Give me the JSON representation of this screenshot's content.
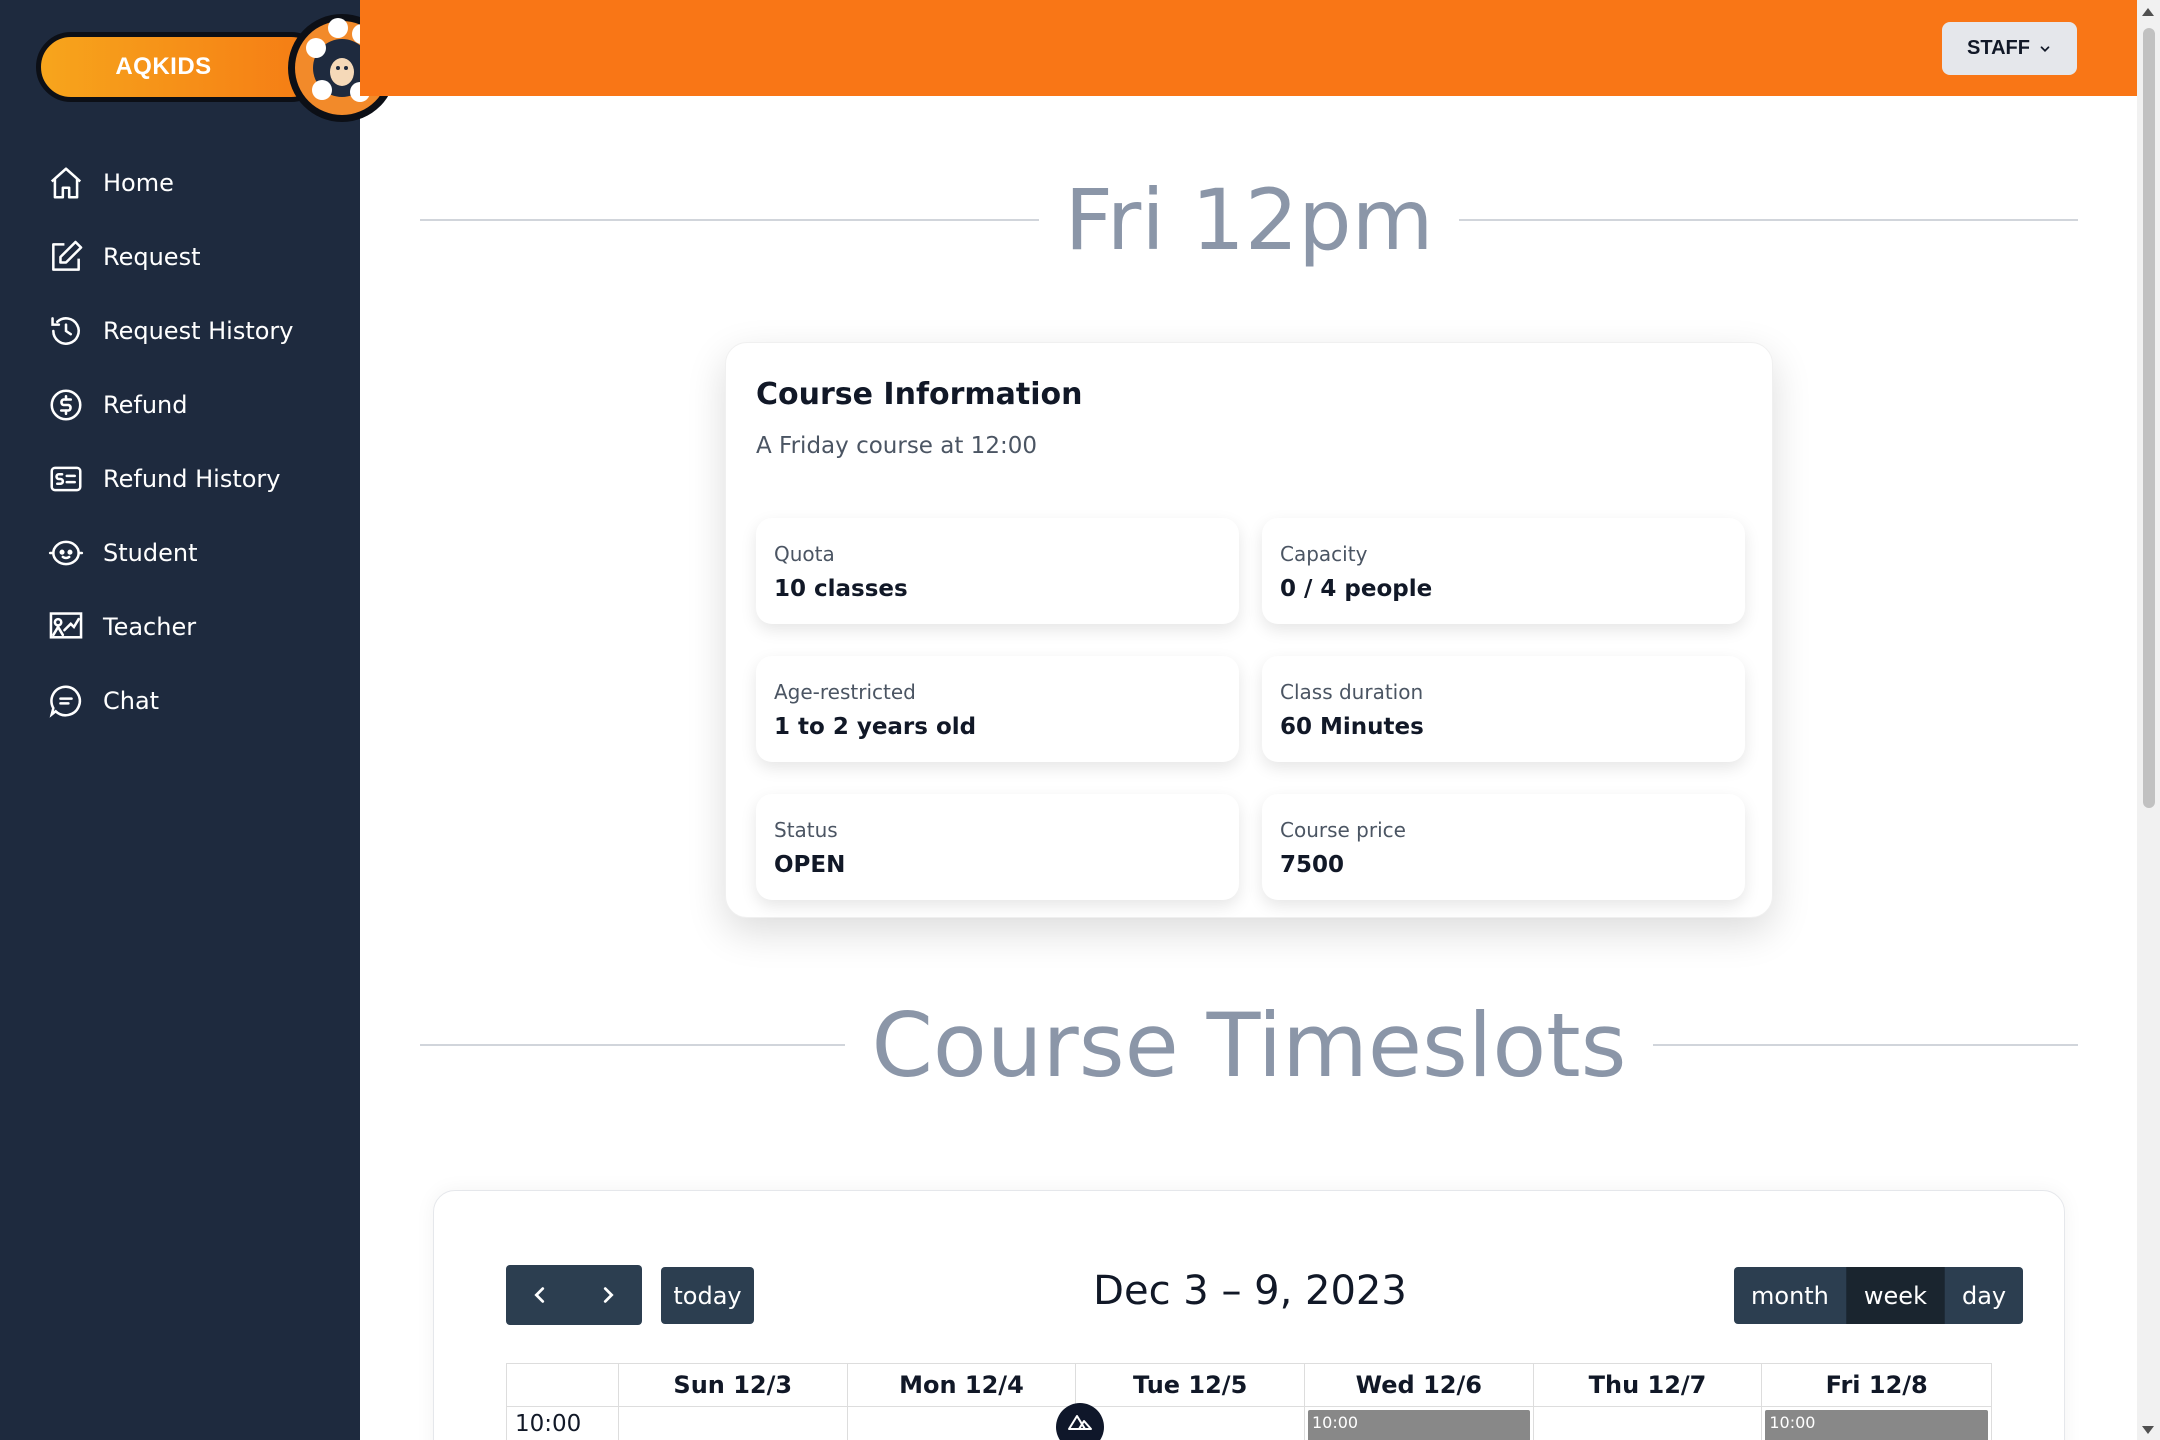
{
  "brand": {
    "name": "AQKIDS"
  },
  "nav": [
    {
      "label": "Home",
      "icon": "home-icon"
    },
    {
      "label": "Request",
      "icon": "edit-icon"
    },
    {
      "label": "Request History",
      "icon": "history-icon"
    },
    {
      "label": "Refund",
      "icon": "dollar-icon"
    },
    {
      "label": "Refund History",
      "icon": "receipt-icon"
    },
    {
      "label": "Student",
      "icon": "baby-icon"
    },
    {
      "label": "Teacher",
      "icon": "chalkboard-icon"
    },
    {
      "label": "Chat",
      "icon": "chat-icon"
    }
  ],
  "topbar": {
    "user_menu": "STAFF"
  },
  "page": {
    "title": "Fri 12pm"
  },
  "course_info": {
    "title": "Course Information",
    "subtitle": "A Friday course at 12:00",
    "fields": [
      {
        "label": "Quota",
        "value": "10 classes"
      },
      {
        "label": "Capacity",
        "value": "0 / 4 people"
      },
      {
        "label": "Age-restricted",
        "value": "1 to 2 years old"
      },
      {
        "label": "Class duration",
        "value": "60 Minutes"
      },
      {
        "label": "Status",
        "value": "OPEN"
      },
      {
        "label": "Course price",
        "value": "7500"
      }
    ]
  },
  "timeslots": {
    "title": "Course Timeslots",
    "today_label": "today",
    "range": "Dec 3 – 9, 2023",
    "views": [
      "month",
      "week",
      "day"
    ],
    "active_view": "week",
    "days": [
      "Sun 12/3",
      "Mon 12/4",
      "Tue 12/5",
      "Wed 12/6",
      "Thu 12/7",
      "Fri 12/8"
    ],
    "time_row": "10:00 AM",
    "events": {
      "wed": "10:00",
      "fri": "10:00"
    }
  },
  "colors": {
    "sidebar": "#1e2a3e",
    "topbar": "#f97616",
    "button": "#2c3e50",
    "event": "#888888"
  }
}
